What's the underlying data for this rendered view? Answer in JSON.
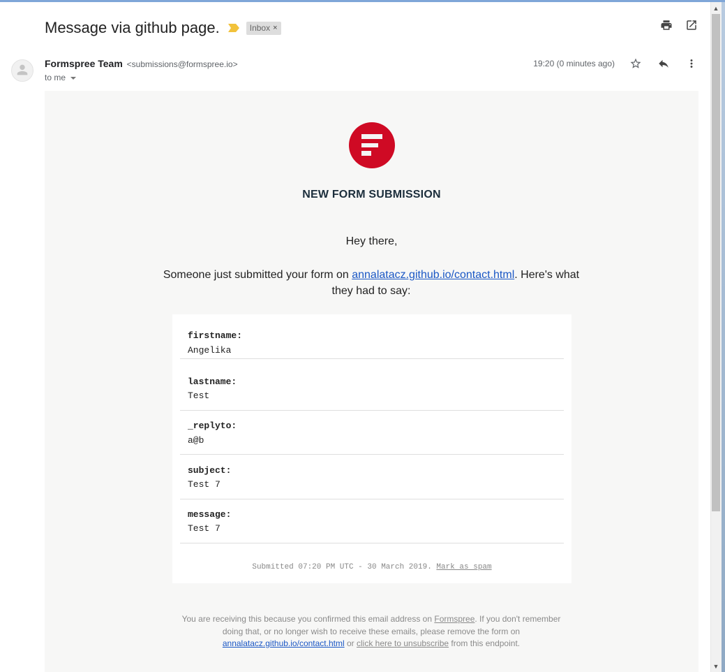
{
  "email": {
    "subject": "Message via github page.",
    "label": "Inbox",
    "label_remove": "×",
    "sender_name": "Formspree Team",
    "sender_email": "<submissions@formspree.io>",
    "recipient": "to me",
    "time": "19:20 (0 minutes ago)"
  },
  "body": {
    "heading": "NEW FORM SUBMISSION",
    "greeting": "Hey there,",
    "intro_before": "Someone just submitted your form on ",
    "intro_link": "annalatacz.github.io/contact.html",
    "intro_after": ". Here's what they had to say:",
    "fields": [
      {
        "key": "firstname:",
        "value": "Angelika"
      },
      {
        "key": "lastname:",
        "value": "Test"
      },
      {
        "key": "_replyto:",
        "value": "a@b"
      },
      {
        "key": "subject:",
        "value": "Test 7"
      },
      {
        "key": "message:",
        "value": "Test 7"
      }
    ],
    "submitted_text": "Submitted 07:20 PM UTC - 30 March 2019. ",
    "spam_link": "Mark as spam"
  },
  "footer": {
    "part1": "You are receiving this because you confirmed this email address on ",
    "formspree_link": "Formspree",
    "part2": ". If you don't remember doing that, or no longer wish to receive these emails, please remove the form on ",
    "form_link": "annalatacz.github.io/contact.html",
    "part3": " or ",
    "unsubscribe_link": "click here to unsubscribe",
    "part4": " from this endpoint."
  },
  "icons": {
    "importance": "importance-marker-icon",
    "print": "print-icon",
    "open_new": "open-in-new-window-icon",
    "star": "star-icon",
    "reply": "reply-icon",
    "more": "more-vert-icon",
    "avatar": "person-icon"
  },
  "colors": {
    "brand": "#cf0a24",
    "link": "#1a57c5",
    "importance": "#f2c23b",
    "label_chip": "#dddddd"
  }
}
